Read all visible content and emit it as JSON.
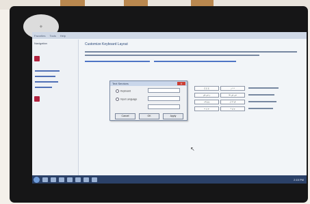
{
  "window": {
    "menu": [
      "Favorites",
      "Tools",
      "Help"
    ],
    "cursor_icon": "arrow-cursor"
  },
  "sidebar": {
    "title": "Navigation",
    "items": [
      "",
      "",
      "",
      ""
    ]
  },
  "main": {
    "heading": "Customize Keyboard Layout"
  },
  "dialog": {
    "title": "Text Services",
    "close_label": "X",
    "label1": "Keyboard",
    "label2": "Input Language",
    "input_value": "",
    "buttons": [
      "Cancel",
      "OK",
      "Apply"
    ]
  },
  "arabic_keys": [
    "ج ح خ",
    "د ذ ر",
    "ز س ش",
    "ص ض ط",
    "ع غ ف",
    "ق ك ل",
    "م ن ه",
    "و ي ء"
  ],
  "taskbar": {
    "clock": "2:15 PM"
  }
}
